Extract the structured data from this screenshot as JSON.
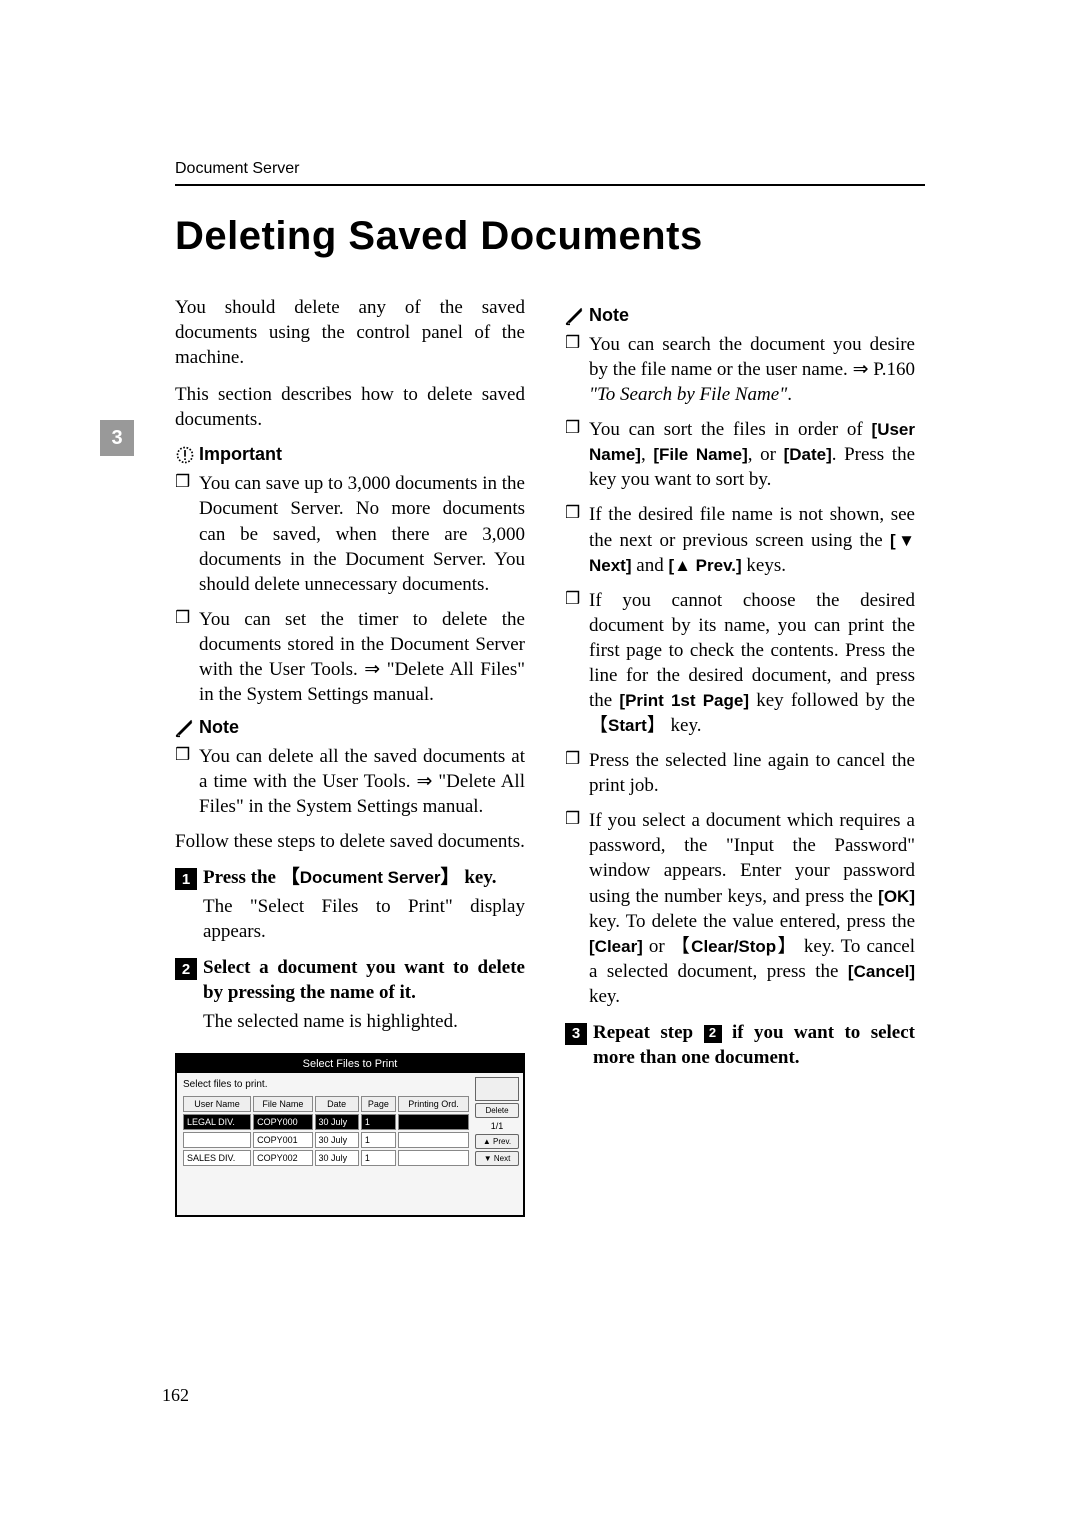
{
  "running_head": "Document Server",
  "title": "Deleting Saved Documents",
  "side_tab": "3",
  "page_number": "162",
  "intro": {
    "p1": "You should delete any of the saved documents using the control panel of the machine.",
    "p2": "This section describes how to delete saved documents."
  },
  "important": {
    "label": "Important",
    "items": [
      "You can save up to 3,000 documents in the Document Server. No more documents can be saved, when there are 3,000 documents in the Document Server. You should delete unnecessary documents.",
      "You can set the timer to delete the documents stored in the Document Server with the User Tools. ⇒ \"Delete All Files\" in the System Settings manual."
    ]
  },
  "note_left": {
    "label": "Note",
    "items": [
      "You can delete all the saved documents at a time with the User Tools. ⇒ \"Delete All Files\" in the System Settings manual."
    ]
  },
  "lead": "Follow these steps to delete saved documents.",
  "step1": {
    "num": "1",
    "pre": "Press the ",
    "key_open": "【",
    "key": "Document Server",
    "key_close": "】",
    "post": " key.",
    "body": "The \"Select Files to Print\" display appears."
  },
  "step2": {
    "num": "2",
    "head": "Select a document you want to delete by pressing the name of it.",
    "body": "The selected name is highlighted."
  },
  "note_right": {
    "label": "Note",
    "n1_a": "You can search the document you desire by the file name or the user name. ⇒ P.160 ",
    "n1_b": "\"To Search by File Name\"",
    "n1_c": ".",
    "n2_a": "You can sort the files in order of ",
    "n2_user": "[User Name]",
    "n2_sep1": ", ",
    "n2_file": "[File Name]",
    "n2_sep2": ", or ",
    "n2_date": "[Date]",
    "n2_b": ". Press the key you want to sort by.",
    "n3_a": "If the desired file name is not shown, see the next or previous screen using the ",
    "n3_next": "[▼ Next]",
    "n3_and": " and ",
    "n3_prev": "[▲ Prev.]",
    "n3_b": " keys.",
    "n4_a": "If you cannot choose the desired document by its name, you can print the first page to check the contents. Press the line for the desired document, and press the ",
    "n4_print": "[Print 1st Page]",
    "n4_b": " key followed by the ",
    "n4_startl": "【",
    "n4_start": "Start",
    "n4_startr": "】",
    "n4_c": " key.",
    "n5": "Press the selected line again to cancel the print job.",
    "n6_a": "If you select a document which requires a password, the \"Input the Password\" window appears. Enter your password using the number keys, and press the ",
    "n6_ok": "[OK]",
    "n6_b": " key. To delete the value entered, press the ",
    "n6_clear": "[Clear]",
    "n6_or": " or ",
    "n6_csl": "【",
    "n6_cs": "Clear/Stop",
    "n6_csr": "】",
    "n6_c": " key. To cancel a selected document, press the ",
    "n6_cancel": "[Cancel]",
    "n6_d": " key."
  },
  "step3": {
    "num": "3",
    "pre": "Repeat step ",
    "ref": "2",
    "post": " if you want to select more than one document."
  },
  "shot": {
    "title": "Select Files to Print",
    "subtitle": "Select files to print.",
    "headers": {
      "user": "User Name",
      "file": "File Name",
      "date": "Date",
      "page": "Page"
    },
    "printing": "Printing Ord.",
    "rows": [
      {
        "user": "LEGAL DIV.",
        "file": "COPY000",
        "date": "30 July",
        "page": "1"
      },
      {
        "user": "",
        "file": "COPY001",
        "date": "30 July",
        "page": "1"
      },
      {
        "user": "SALES DIV.",
        "file": "COPY002",
        "date": "30 July",
        "page": "1"
      }
    ],
    "delete_btn": "Delete",
    "page_ind": "1/1",
    "prev_btn": "▲ Prev.",
    "next_btn": "▼ Next"
  }
}
